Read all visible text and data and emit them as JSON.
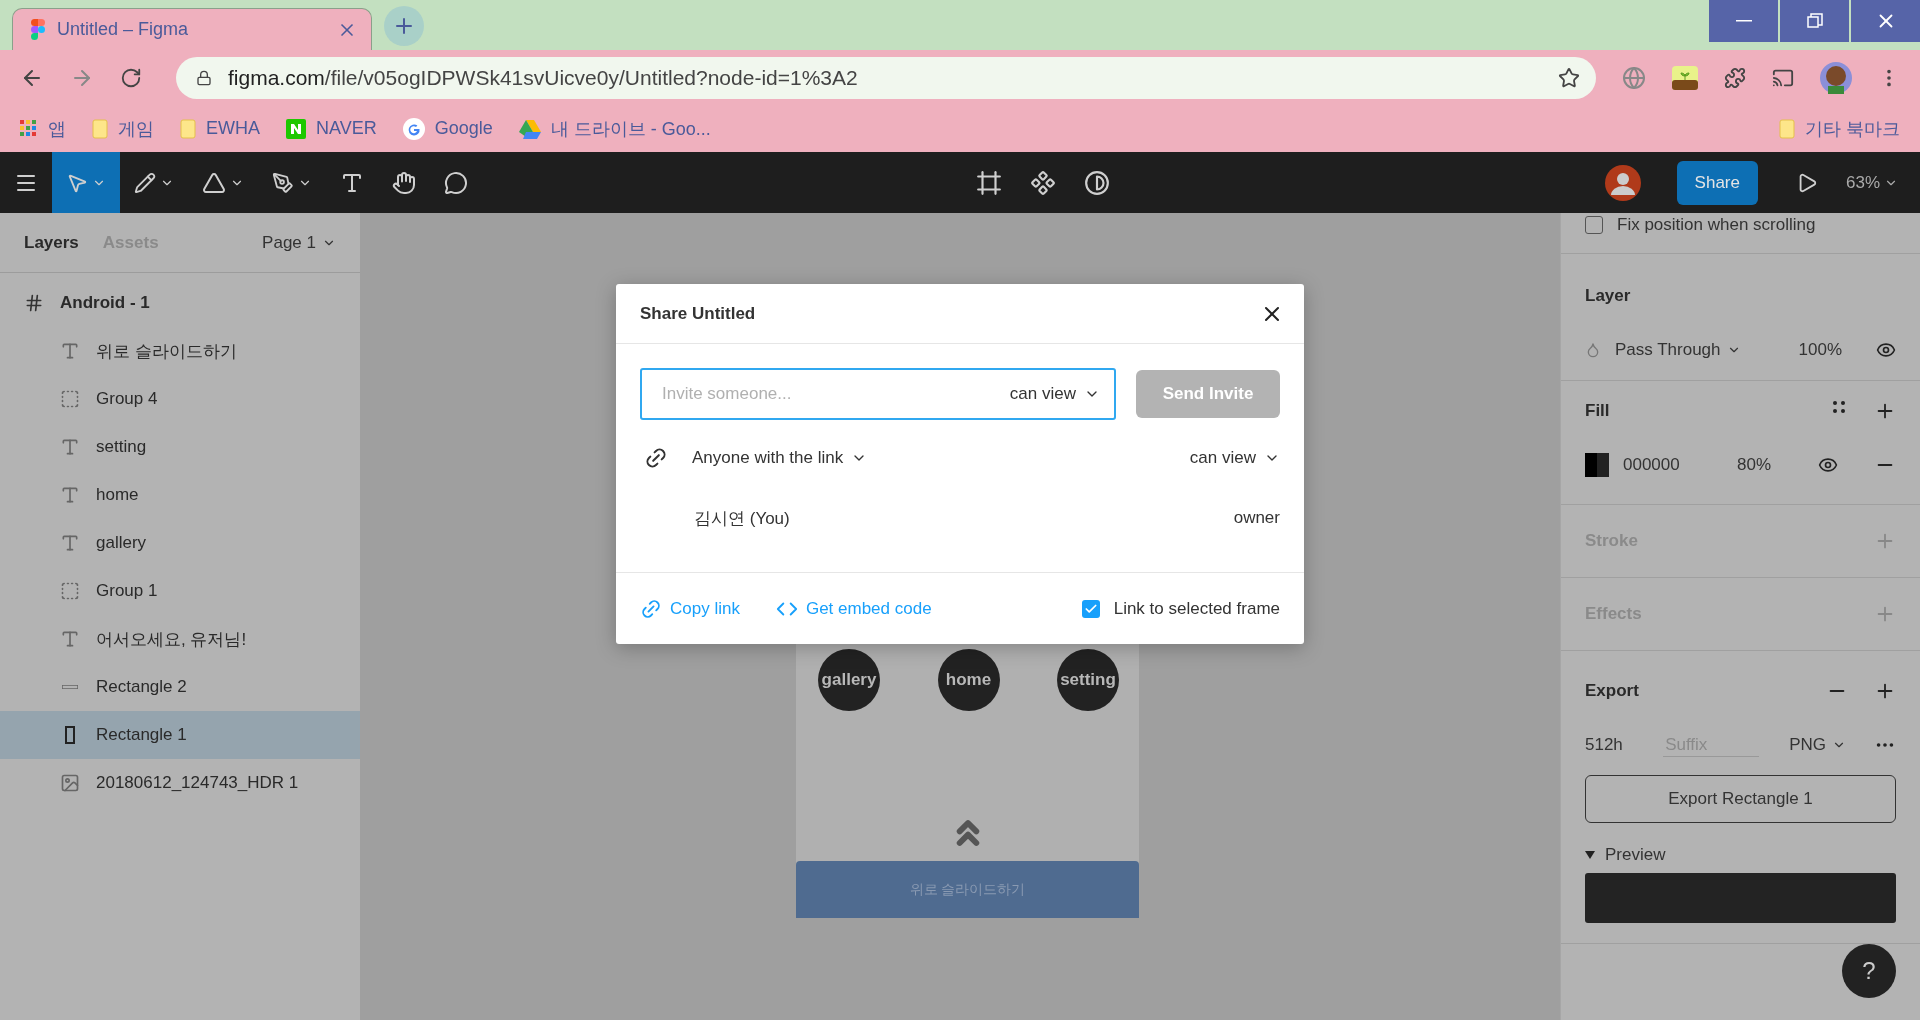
{
  "browser": {
    "tab": {
      "title": "Untitled – Figma",
      "selected": true
    },
    "url": {
      "host": "figma.com",
      "path": "/file/v05ogIDPWSk41svUicve0y/Untitled?node-id=1%3A2"
    },
    "bookmarks": [
      {
        "kind": "apps",
        "label": "앱"
      },
      {
        "kind": "folder",
        "label": "게임"
      },
      {
        "kind": "folder",
        "label": "EWHA"
      },
      {
        "kind": "naver",
        "label": "NAVER"
      },
      {
        "kind": "google",
        "label": "Google"
      },
      {
        "kind": "drive",
        "label": "내 드라이브 - Goo..."
      }
    ],
    "other_bookmarks": "기타 북마크"
  },
  "toolbar": {
    "tools": [
      {
        "kind": "move",
        "selected": true
      },
      {
        "kind": "shape-pen",
        "selected": false
      },
      {
        "kind": "shape",
        "selected": false
      },
      {
        "kind": "pen",
        "selected": false
      },
      {
        "kind": "text",
        "selected": false
      },
      {
        "kind": "hand",
        "selected": false
      },
      {
        "kind": "comment",
        "selected": false
      }
    ],
    "share": "Share",
    "zoom": "63%"
  },
  "left_panel": {
    "tabs": [
      {
        "label": "Layers",
        "selected": true
      },
      {
        "label": "Assets",
        "selected": false
      }
    ],
    "page": "Page 1",
    "layers": [
      {
        "kind": "frame",
        "name": "Android - 1",
        "selected": false,
        "children": [
          {
            "kind": "text",
            "name": "위로 슬라이드하기",
            "selected": false
          },
          {
            "kind": "group",
            "name": "Group 4",
            "selected": false
          },
          {
            "kind": "text",
            "name": "setting",
            "selected": false
          },
          {
            "kind": "text",
            "name": "home",
            "selected": false
          },
          {
            "kind": "text",
            "name": "gallery",
            "selected": false
          },
          {
            "kind": "group",
            "name": "Group 1",
            "selected": false
          },
          {
            "kind": "text",
            "name": "어서오세요, 유저님!",
            "selected": false
          },
          {
            "kind": "line",
            "name": "Rectangle 2",
            "selected": false
          },
          {
            "kind": "rect",
            "name": "Rectangle 1",
            "selected": true
          },
          {
            "kind": "image",
            "name": "20180612_124743_HDR 1",
            "selected": false
          }
        ]
      }
    ]
  },
  "canvas": {
    "nav": [
      "gallery",
      "home",
      "setting"
    ],
    "slide_label": "위로 슬라이드하기"
  },
  "dialog": {
    "title": "Share Untitled",
    "invite_placeholder": "Invite someone...",
    "invite_permission": "can view",
    "send_button": {
      "label": "Send Invite",
      "disabled": true
    },
    "link_access": "Anyone with the link",
    "link_permission": "can view",
    "members": [
      {
        "name": "김시연 (You)",
        "role": "owner"
      }
    ],
    "copy_link": "Copy link",
    "embed": "Get embed code",
    "link_frame": {
      "label": "Link to selected frame",
      "checked": true
    }
  },
  "right_panel": {
    "fix_position": {
      "label": "Fix position when scrolling",
      "checked": false
    },
    "layer": {
      "title": "Layer",
      "blend": "Pass Through",
      "opacity": "100%"
    },
    "fill": {
      "title": "Fill",
      "hex": "000000",
      "opacity": "80%"
    },
    "stroke": {
      "title": "Stroke",
      "active": false
    },
    "effects": {
      "title": "Effects",
      "active": false
    },
    "export": {
      "title": "Export",
      "size": "512h",
      "suffix_placeholder": "Suffix",
      "format": "PNG",
      "button": "Export Rectangle 1"
    },
    "preview": {
      "label": "Preview",
      "expanded": true
    },
    "help": "?"
  }
}
